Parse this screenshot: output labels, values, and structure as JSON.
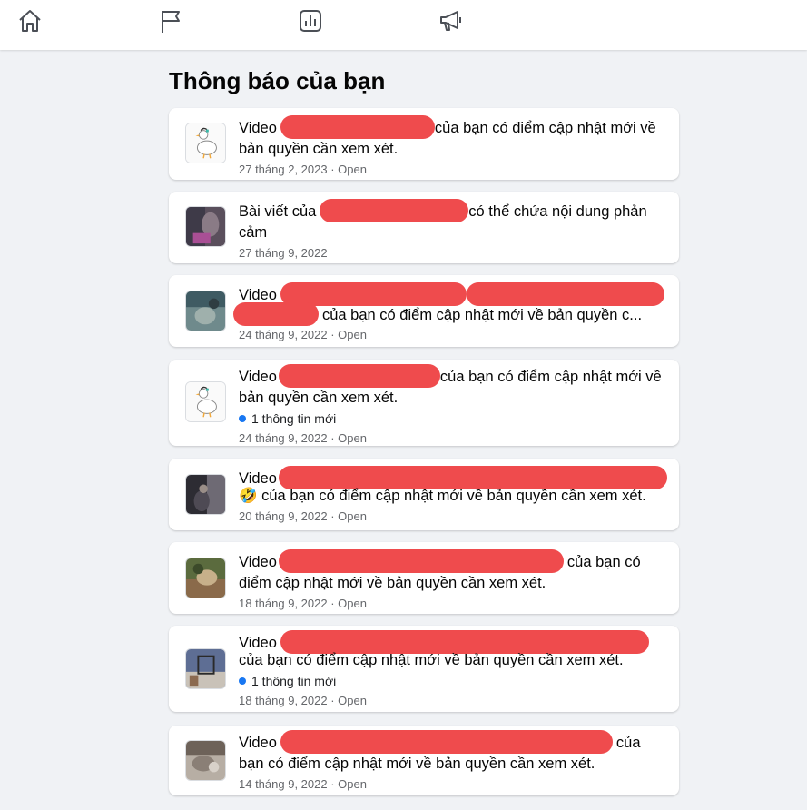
{
  "nav": {
    "home": "home-icon",
    "pages": "flag-icon",
    "insights": "bar-chart-icon",
    "ads": "megaphone-icon"
  },
  "page_title": "Thông báo của bạn",
  "notifications": [
    {
      "prefix": "Video",
      "suffix": "của bạn có điểm cập nhật mới về bản quyền cần xem xét.",
      "date": "27 tháng 2, 2023",
      "open": "Open"
    },
    {
      "prefix": "Bài viết của",
      "suffix": "có thể chứa nội dung phản cảm",
      "date": "27 tháng 9, 2022",
      "open": "Open"
    },
    {
      "prefix": "Video",
      "suffix": "của bạn có điểm cập nhật mới về bản quyền c...",
      "date": "24 tháng 9, 2022",
      "open": "Open"
    },
    {
      "prefix": "Video",
      "suffix": "của bạn có điểm cập nhật mới về bản quyền cần xem xét.",
      "badge": "1 thông tin mới",
      "date": "24 tháng 9, 2022",
      "open": "Open"
    },
    {
      "prefix": "Video",
      "suffix": "🤣 của bạn có điểm cập nhật mới về bản quyền cần xem xét.",
      "date": "20 tháng 9, 2022",
      "open": "Open"
    },
    {
      "prefix": "Video",
      "suffix": "của bạn có điểm cập nhật mới về bản quyền cần xem xét.",
      "date": "18 tháng 9, 2022",
      "open": "Open"
    },
    {
      "prefix": "Video",
      "suffix": "của bạn có điểm cập nhật mới về bản quyền cần xem xét.",
      "badge": "1 thông tin mới",
      "date": "18 tháng 9, 2022",
      "open": "Open"
    },
    {
      "prefix": "Video",
      "suffix": "của bạn có điểm cập nhật mới về bản quyền cần xem xét.",
      "date": "14 tháng 9, 2022",
      "open": "Open"
    }
  ]
}
